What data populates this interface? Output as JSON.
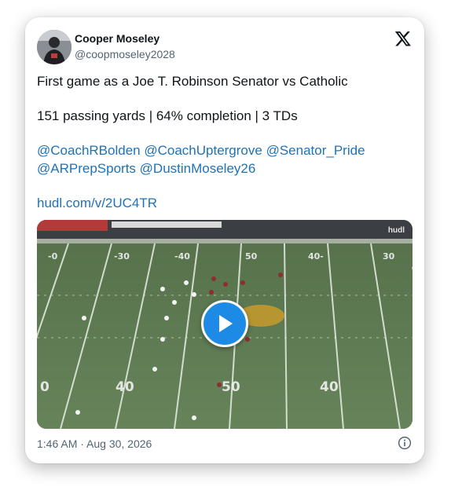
{
  "author": {
    "name": "Cooper Moseley",
    "handle": "@coopmoseley2028"
  },
  "tweet": {
    "line1": "First game as a Joe T. Robinson Senator vs Catholic",
    "line2": "151 passing yards | 64% completion | 3 TDs",
    "mentions_row1": [
      "@CoachRBolden",
      "@CoachUptergrove",
      "@Senator_Pride"
    ],
    "mentions_row2": [
      "@ARPrepSports",
      "@DustinMoseley26"
    ],
    "link": "hudl.com/v/2UC4TR"
  },
  "media": {
    "watermark": "hudl",
    "yard_numbers": [
      "-0",
      "-30",
      "-40",
      "50",
      "40-",
      "30",
      "0",
      "40",
      "50",
      "40"
    ]
  },
  "footer": {
    "timestamp": "1:46 AM · Aug 30, 2026"
  },
  "icons": {
    "brand": "x-logo-icon",
    "play": "play-icon",
    "info": "info-icon"
  },
  "colors": {
    "link": "#1d72b8",
    "play_button": "#1d8ae6",
    "field": "#5d7a4e"
  }
}
